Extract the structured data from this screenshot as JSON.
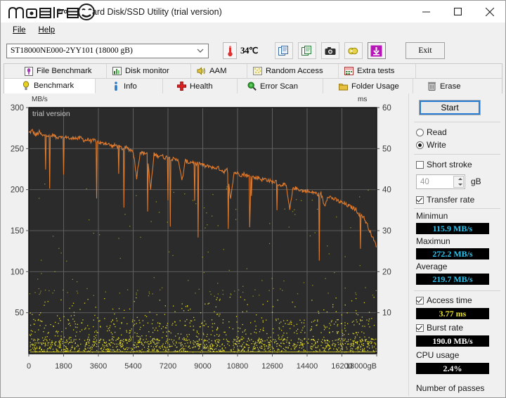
{
  "window": {
    "title": "HD Tune Pro 5.75 Hard Disk/SSD Utility (trial version)",
    "title_visible": "ard Disk/SSD Utility (trial version)",
    "watermark": "mobile01",
    "minimize_icon": "minimize-icon",
    "maximize_icon": "maximize-icon",
    "close_icon": "close-icon"
  },
  "menu": {
    "items": [
      {
        "label": "File",
        "accel": "F"
      },
      {
        "label": "Help",
        "accel": "H"
      }
    ]
  },
  "toolbar": {
    "device": "ST18000NE000-2YY101 (18000 gB)",
    "device_options": [
      "ST18000NE000-2YY101 (18000 gB)"
    ],
    "temperature": "34°C",
    "temperature_display": "34",
    "temperature_icon": "thermometer-icon",
    "buttons": [
      {
        "name": "copy-icon",
        "label": "Copy"
      },
      {
        "name": "copy-excel-icon",
        "label": "Copy to Excel"
      },
      {
        "name": "screenshot-icon",
        "label": "Screenshot"
      },
      {
        "name": "settings-icon",
        "label": "Options"
      },
      {
        "name": "download-icon",
        "label": "Save"
      }
    ],
    "exit_label": "Exit"
  },
  "tabs": {
    "row1": [
      {
        "label": "File Benchmark",
        "icon": "file-benchmark-icon",
        "active": false
      },
      {
        "label": "Disk monitor",
        "icon": "disk-monitor-icon",
        "active": false
      },
      {
        "label": "AAM",
        "icon": "aam-speaker-icon",
        "active": false
      },
      {
        "label": "Random Access",
        "icon": "random-access-icon",
        "active": false
      },
      {
        "label": "Extra tests",
        "icon": "extra-tests-icon",
        "active": false
      }
    ],
    "row2": [
      {
        "label": "Benchmark",
        "icon": "benchmark-bulb-icon",
        "active": true
      },
      {
        "label": "Info",
        "icon": "info-icon",
        "active": false
      },
      {
        "label": "Health",
        "icon": "health-cross-icon",
        "active": false
      },
      {
        "label": "Error Scan",
        "icon": "error-scan-magnifier-icon",
        "active": false
      },
      {
        "label": "Folder Usage",
        "icon": "folder-usage-icon",
        "active": false
      },
      {
        "label": "Erase",
        "icon": "erase-trash-icon",
        "active": false
      }
    ]
  },
  "panel": {
    "start_label": "Start",
    "mode_read": "Read",
    "mode_write": "Write",
    "mode_selected": "Write",
    "short_stroke_label": "Short stroke",
    "short_stroke_checked": false,
    "short_stroke_value": "40",
    "short_stroke_unit": "gB",
    "transfer_rate_label": "Transfer rate",
    "transfer_rate_checked": true,
    "minimum_label": "Minimun",
    "minimum_value": "115.9 MB/s",
    "maximum_label": "Maximun",
    "maximum_value": "272.2 MB/s",
    "average_label": "Average",
    "average_value": "219.7 MB/s",
    "access_time_label": "Access time",
    "access_time_checked": true,
    "access_time_value": "3.77 ms",
    "burst_rate_label": "Burst rate",
    "burst_rate_checked": true,
    "burst_rate_value": "190.0 MB/s",
    "cpu_usage_label": "CPU usage",
    "cpu_usage_value": "2.4%",
    "passes_label": "Number of passes"
  },
  "colors": {
    "transfer_curve": "#e07b2e",
    "access_dots": "#e8e02a",
    "burst_marker": "#ffffff",
    "plot_bg": "#2b2b2b",
    "grid": "#6e6e6e",
    "readout_cyan": "#2ec4f0",
    "readout_yellow": "#e8e02a",
    "accent": "#2a7fd4"
  },
  "chart_data": {
    "type": "line",
    "title": "",
    "trial_watermark": "trial version",
    "ylabel": "MB/s",
    "y2label": "ms",
    "xlabel": "gB",
    "xlim": [
      0,
      18000
    ],
    "ylim": [
      0,
      300
    ],
    "y2lim": [
      0,
      60
    ],
    "grid": true,
    "xticks": [
      0,
      1800,
      3600,
      5400,
      7200,
      9000,
      10800,
      12600,
      14400,
      16200,
      18000
    ],
    "xtick_labels": [
      "0",
      "1800",
      "3600",
      "5400",
      "7200",
      "9000",
      "10800",
      "12600",
      "14400",
      "16200",
      "18000gB"
    ],
    "yticks": [
      50,
      100,
      150,
      200,
      250,
      300
    ],
    "y2ticks": [
      10,
      20,
      30,
      40,
      50,
      60
    ],
    "series": [
      {
        "name": "Transfer rate",
        "unit": "MB/s",
        "axis": "left",
        "color": "#e07b2e",
        "x": [
          0,
          180,
          360,
          540,
          720,
          900,
          1080,
          1260,
          1440,
          1620,
          1800,
          1980,
          2160,
          2340,
          2520,
          2700,
          2880,
          3060,
          3240,
          3420,
          3600,
          3780,
          3960,
          4140,
          4320,
          4500,
          4680,
          4860,
          5040,
          5220,
          5400,
          5580,
          5760,
          5940,
          6120,
          6300,
          6480,
          6660,
          6840,
          7020,
          7200,
          7380,
          7560,
          7740,
          7920,
          8100,
          8280,
          8460,
          8640,
          8820,
          9000,
          9180,
          9360,
          9540,
          9720,
          9900,
          10080,
          10260,
          10440,
          10620,
          10800,
          10980,
          11160,
          11340,
          11520,
          11700,
          11880,
          12060,
          12240,
          12420,
          12600,
          12780,
          12960,
          13140,
          13320,
          13500,
          13680,
          13860,
          14040,
          14220,
          14400,
          14580,
          14760,
          14940,
          15120,
          15300,
          15480,
          15660,
          15840,
          16020,
          16200,
          16380,
          16560,
          16740,
          16920,
          17100,
          17280,
          17460,
          17640,
          17820,
          18000
        ],
        "y": [
          269,
          272,
          266,
          270,
          265,
          268,
          264,
          267,
          263,
          266,
          262,
          265,
          261,
          264,
          262,
          263,
          260,
          261,
          259,
          260,
          258,
          256,
          257,
          255,
          253,
          254,
          252,
          250,
          251,
          249,
          247,
          215,
          246,
          244,
          245,
          200,
          243,
          241,
          242,
          239,
          240,
          238,
          236,
          237,
          210,
          235,
          233,
          234,
          231,
          232,
          230,
          228,
          229,
          226,
          227,
          225,
          222,
          224,
          190,
          221,
          220,
          218,
          219,
          216,
          217,
          214,
          215,
          212,
          213,
          211,
          209,
          210,
          205,
          207,
          204,
          175,
          203,
          201,
          200,
          198,
          199,
          196,
          197,
          194,
          195,
          180,
          193,
          190,
          188,
          186,
          184,
          182,
          180,
          178,
          176,
          170,
          168,
          160,
          150,
          140,
          130
        ],
        "label_min": "115.9 MB/s",
        "label_max": "272.2 MB/s",
        "label_avg": "219.7 MB/s"
      },
      {
        "name": "Access time",
        "unit": "ms",
        "axis": "right",
        "color": "#e8e02a",
        "style": "scatter",
        "average": 3.77
      }
    ]
  }
}
